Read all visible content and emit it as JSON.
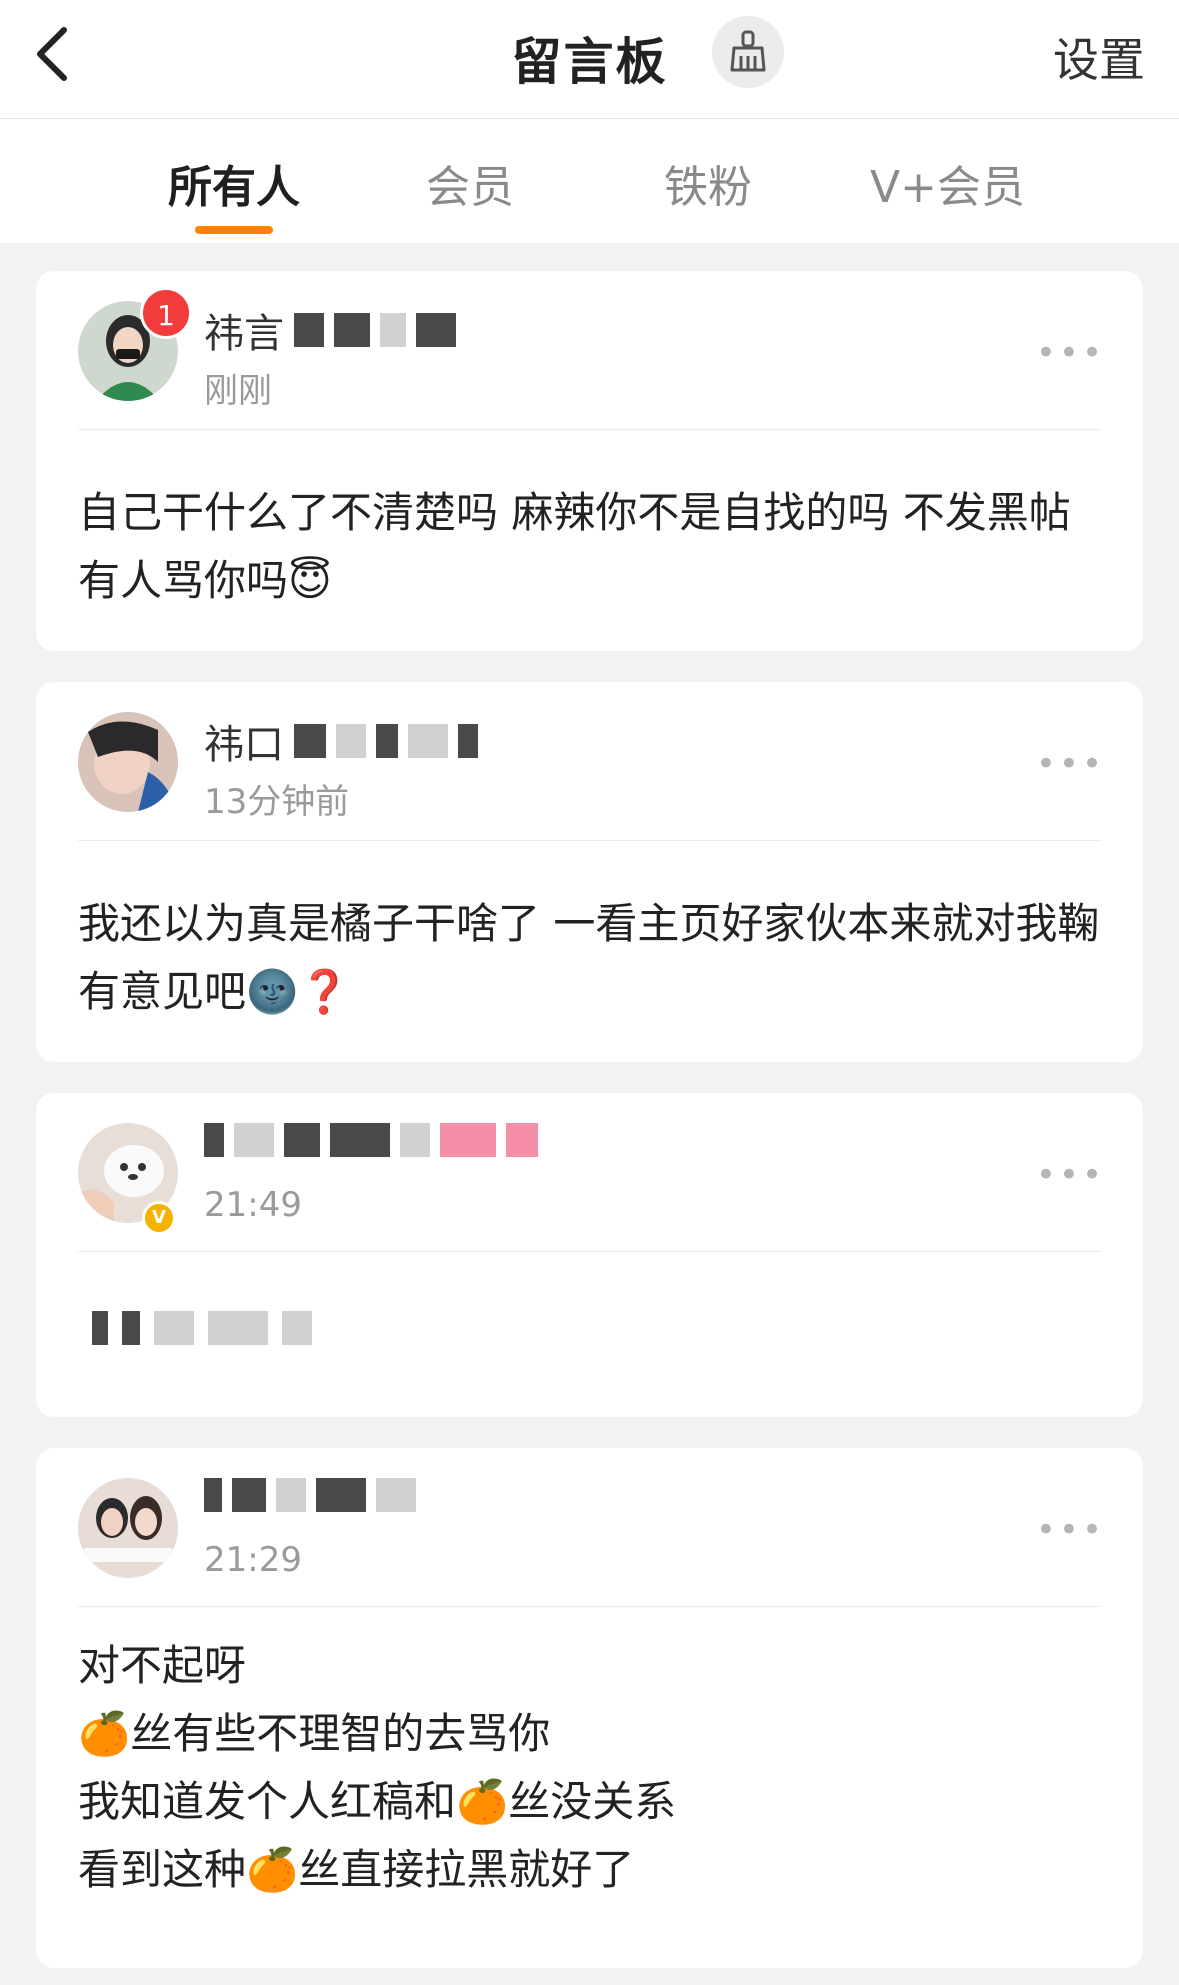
{
  "header": {
    "title": "留言板",
    "settings_label": "设置",
    "back_icon": "chevron-left-icon",
    "clean_icon": "broom-icon"
  },
  "tabs": [
    {
      "label": "所有人",
      "active": true
    },
    {
      "label": "会员",
      "active": false
    },
    {
      "label": "铁粉",
      "active": false
    },
    {
      "label": "V+会员",
      "active": false
    }
  ],
  "colors": {
    "accent": "#ff8200",
    "badge": "#f23c3c",
    "verified": "#f5b300"
  },
  "messages": [
    {
      "name_visible": "祎言",
      "unread_badge": "1",
      "time": "刚刚",
      "content": "自己干什么了不清楚吗 麻辣你不是自找的吗 不发黑帖有人骂你吗😇"
    },
    {
      "name_visible": "祎口",
      "time": "13分钟前",
      "content": "我还以为真是橘子干啥了 一看主页好家伙本来就对我鞠有意见吧🌚❓"
    },
    {
      "name_visible": "",
      "verified": true,
      "time": "21:49",
      "content": ""
    },
    {
      "name_visible": "",
      "time": "21:29",
      "content": "对不起呀\n🍊丝有些不理智的去骂你\n我知道发个人红稿和🍊丝没关系\n看到这种🍊丝直接拉黑就好了"
    }
  ]
}
